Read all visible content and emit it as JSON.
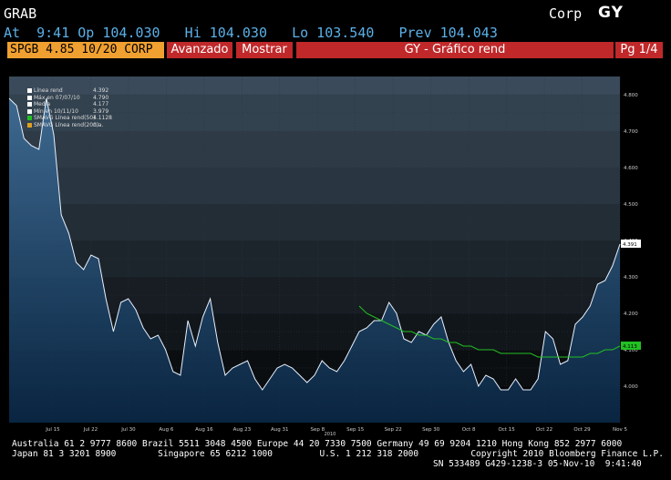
{
  "header": {
    "ticker": "GRAB",
    "corp": "Corp",
    "function": "GY",
    "quote_line": "At  9:41 Op 104.030   Hi 104.030   Lo 103.540   Prev 104.043"
  },
  "toolbar": {
    "security": "SPGB 4.85 10/20 CORP",
    "advanced": "Avanzado",
    "show": "Mostrar",
    "title": "GY - Gráfico rend",
    "page": "Pg 1/4"
  },
  "legend": [
    {
      "name": "Línea rend",
      "value": "4.392",
      "color": "#ffffff"
    },
    {
      "name": "Máx en 07/07/10",
      "value": "4.790",
      "color": "#ffffff"
    },
    {
      "name": "Media",
      "value": "4.177",
      "color": "#ffffff"
    },
    {
      "name": "Mín en 10/11/10",
      "value": "3.979",
      "color": "#ffffff"
    },
    {
      "name": "SMAVG Línea rend(50)",
      "value": "4.1128",
      "color": "#22c022"
    },
    {
      "name": "SMAVG Línea rend(200)",
      "value": "n.a.",
      "color": "#e0a020"
    }
  ],
  "chart_data": {
    "type": "area",
    "x_labels": [
      "Jul 15",
      "Jul 22",
      "Jul 30",
      "Aug 6",
      "Aug 16",
      "Aug 23",
      "Aug 31",
      "Sep 8",
      "Sep 15",
      "Sep 22",
      "Sep 30",
      "Oct 8",
      "Oct 15",
      "Oct 22",
      "Oct 29",
      "Nov 5"
    ],
    "year_label": "2010",
    "y_ticks": [
      "4.800",
      "4.700",
      "4.600",
      "4.500",
      "4.400",
      "4.300",
      "4.200",
      "4.100",
      "4.000"
    ],
    "ylim": [
      3.9,
      4.85
    ],
    "last_value_label": "4.391",
    "ma_value_label": "4.113",
    "series": [
      {
        "name": "Línea rend",
        "color": "#e8f0ff",
        "values": [
          4.79,
          4.77,
          4.68,
          4.66,
          4.65,
          4.79,
          4.69,
          4.47,
          4.42,
          4.34,
          4.32,
          4.36,
          4.35,
          4.24,
          4.15,
          4.23,
          4.24,
          4.21,
          4.16,
          4.13,
          4.14,
          4.1,
          4.04,
          4.03,
          4.18,
          4.11,
          4.19,
          4.24,
          4.12,
          4.03,
          4.05,
          4.06,
          4.07,
          4.02,
          3.99,
          4.02,
          4.05,
          4.06,
          4.05,
          4.03,
          4.01,
          4.03,
          4.07,
          4.05,
          4.04,
          4.07,
          4.11,
          4.15,
          4.16,
          4.18,
          4.18,
          4.23,
          4.2,
          4.13,
          4.12,
          4.15,
          4.14,
          4.17,
          4.19,
          4.12,
          4.07,
          4.04,
          4.06,
          4.0,
          4.03,
          4.02,
          3.99,
          3.99,
          4.02,
          3.99,
          3.99,
          4.02,
          4.15,
          4.13,
          4.06,
          4.07,
          4.17,
          4.19,
          4.22,
          4.28,
          4.29,
          4.33,
          4.39
        ]
      },
      {
        "name": "SMAVG Línea rend(50)",
        "color": "#22c022",
        "values": [
          null,
          null,
          null,
          null,
          null,
          null,
          null,
          null,
          null,
          null,
          null,
          null,
          null,
          null,
          null,
          null,
          null,
          null,
          null,
          null,
          null,
          null,
          null,
          null,
          null,
          null,
          null,
          null,
          null,
          null,
          null,
          null,
          null,
          null,
          null,
          null,
          null,
          null,
          null,
          null,
          null,
          null,
          null,
          null,
          null,
          null,
          null,
          4.22,
          4.2,
          4.19,
          4.18,
          4.17,
          4.16,
          4.15,
          4.15,
          4.14,
          4.14,
          4.13,
          4.13,
          4.12,
          4.12,
          4.11,
          4.11,
          4.1,
          4.1,
          4.1,
          4.09,
          4.09,
          4.09,
          4.09,
          4.09,
          4.08,
          4.08,
          4.08,
          4.08,
          4.08,
          4.08,
          4.08,
          4.09,
          4.09,
          4.1,
          4.1,
          4.11
        ]
      }
    ]
  },
  "footer": {
    "line1": "Australia 61 2 9777 8600 Brazil 5511 3048 4500 Europe 44 20 7330 7500 Germany 49 69 9204 1210 Hong Kong 852 2977 6000",
    "line2": "Japan 81 3 3201 8900        Singapore 65 6212 1000         U.S. 1 212 318 2000          Copyright 2010 Bloomberg Finance L.P.",
    "line3": "SN 533489 G429-1238-3 05-Nov-10  9:41:40"
  }
}
